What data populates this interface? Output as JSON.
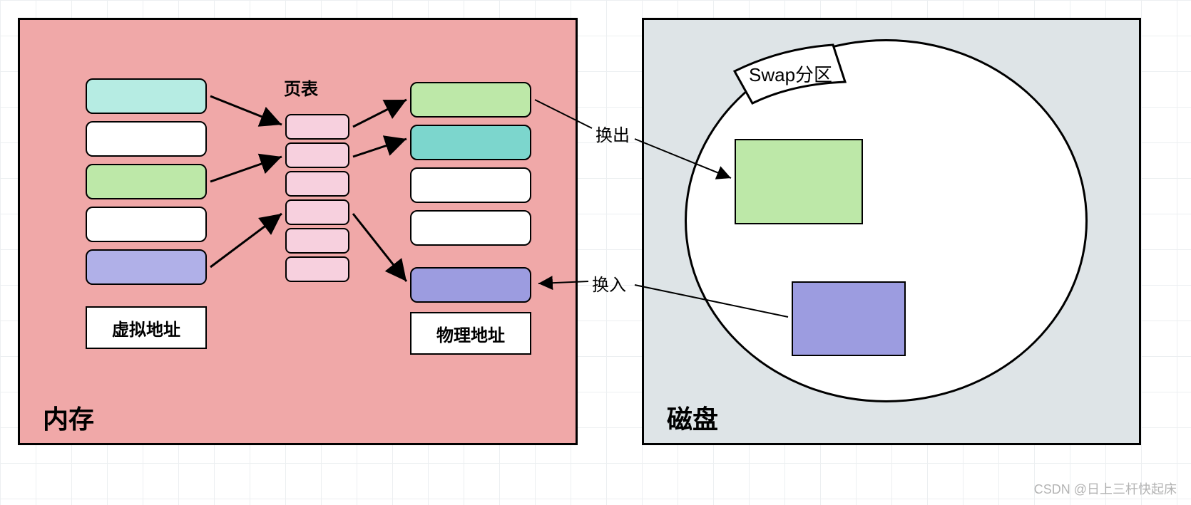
{
  "memory": {
    "title": "内存",
    "page_table_label": "页表",
    "virtual_label": "虚拟地址",
    "physical_label": "物理地址",
    "virtual_cells": [
      {
        "color": "#b6ece3"
      },
      {
        "color": "#ffffff"
      },
      {
        "color": "#bde8a8"
      },
      {
        "color": "#ffffff"
      },
      {
        "color": "#b0b0e8"
      }
    ],
    "page_table_cells": 6,
    "physical_cells": [
      {
        "color": "#bde8a8"
      },
      {
        "color": "#7cd6cd"
      },
      {
        "color": "#ffffff"
      },
      {
        "color": "#ffffff"
      },
      {
        "color": "#9c9ce0"
      }
    ]
  },
  "disk": {
    "title": "磁盘",
    "swap_label": "Swap分区",
    "blocks": [
      {
        "color": "#bde8a8"
      },
      {
        "color": "#9c9ce0"
      }
    ]
  },
  "arrows": {
    "swap_out": "换出",
    "swap_in": "换入"
  },
  "watermark": "CSDN @日上三杆快起床"
}
